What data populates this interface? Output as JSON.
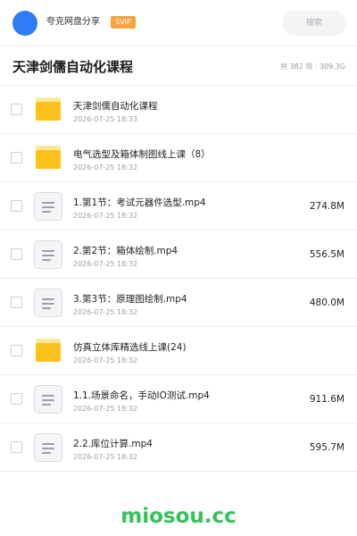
{
  "header": {
    "share_title": "夸克网盘分享",
    "badge": "SVIP",
    "search_placeholder": "搜索",
    "avatar_color": "#2f7cf6"
  },
  "folder": {
    "title": "天津剑儒自动化课程",
    "summary": "共 382 项 · 309.3G"
  },
  "items": [
    {
      "type": "folder",
      "icon": "folder-icon",
      "name": "天津剑儒自动化课程",
      "date": "2026-07-25 18:33",
      "size": ""
    },
    {
      "type": "folder",
      "icon": "folder-icon",
      "name": "电气选型及箱体制图线上课（8）",
      "date": "2026-07-25 18:32",
      "size": ""
    },
    {
      "type": "file",
      "icon": "video-file-icon",
      "name": "1.第1节：考试元器件选型.mp4",
      "date": "2026-07-25 18:32",
      "size": "274.8M"
    },
    {
      "type": "file",
      "icon": "video-file-icon",
      "name": "2.第2节：箱体绘制.mp4",
      "date": "2026-07-25 18:32",
      "size": "556.5M"
    },
    {
      "type": "file",
      "icon": "video-file-icon",
      "name": "3.第3节：原理图绘制.mp4",
      "date": "2026-07-25 18:32",
      "size": "480.0M"
    },
    {
      "type": "folder",
      "icon": "folder-icon",
      "name": "仿真立体库精选线上课(24)",
      "date": "2026-07-25 18:32",
      "size": ""
    },
    {
      "type": "file",
      "icon": "video-file-icon",
      "name": "1.1.场景命名，手动IO测试.mp4",
      "date": "2026-07-25 18:32",
      "size": "911.6M"
    },
    {
      "type": "file",
      "icon": "video-file-icon",
      "name": "2.2.库位计算.mp4",
      "date": "2026-07-25 18:32",
      "size": "595.7M"
    }
  ],
  "watermark": "miosou.cc",
  "colors": {
    "folder": "#ffc21a",
    "badge": "#f7a23b",
    "watermark": "#32c35a"
  }
}
